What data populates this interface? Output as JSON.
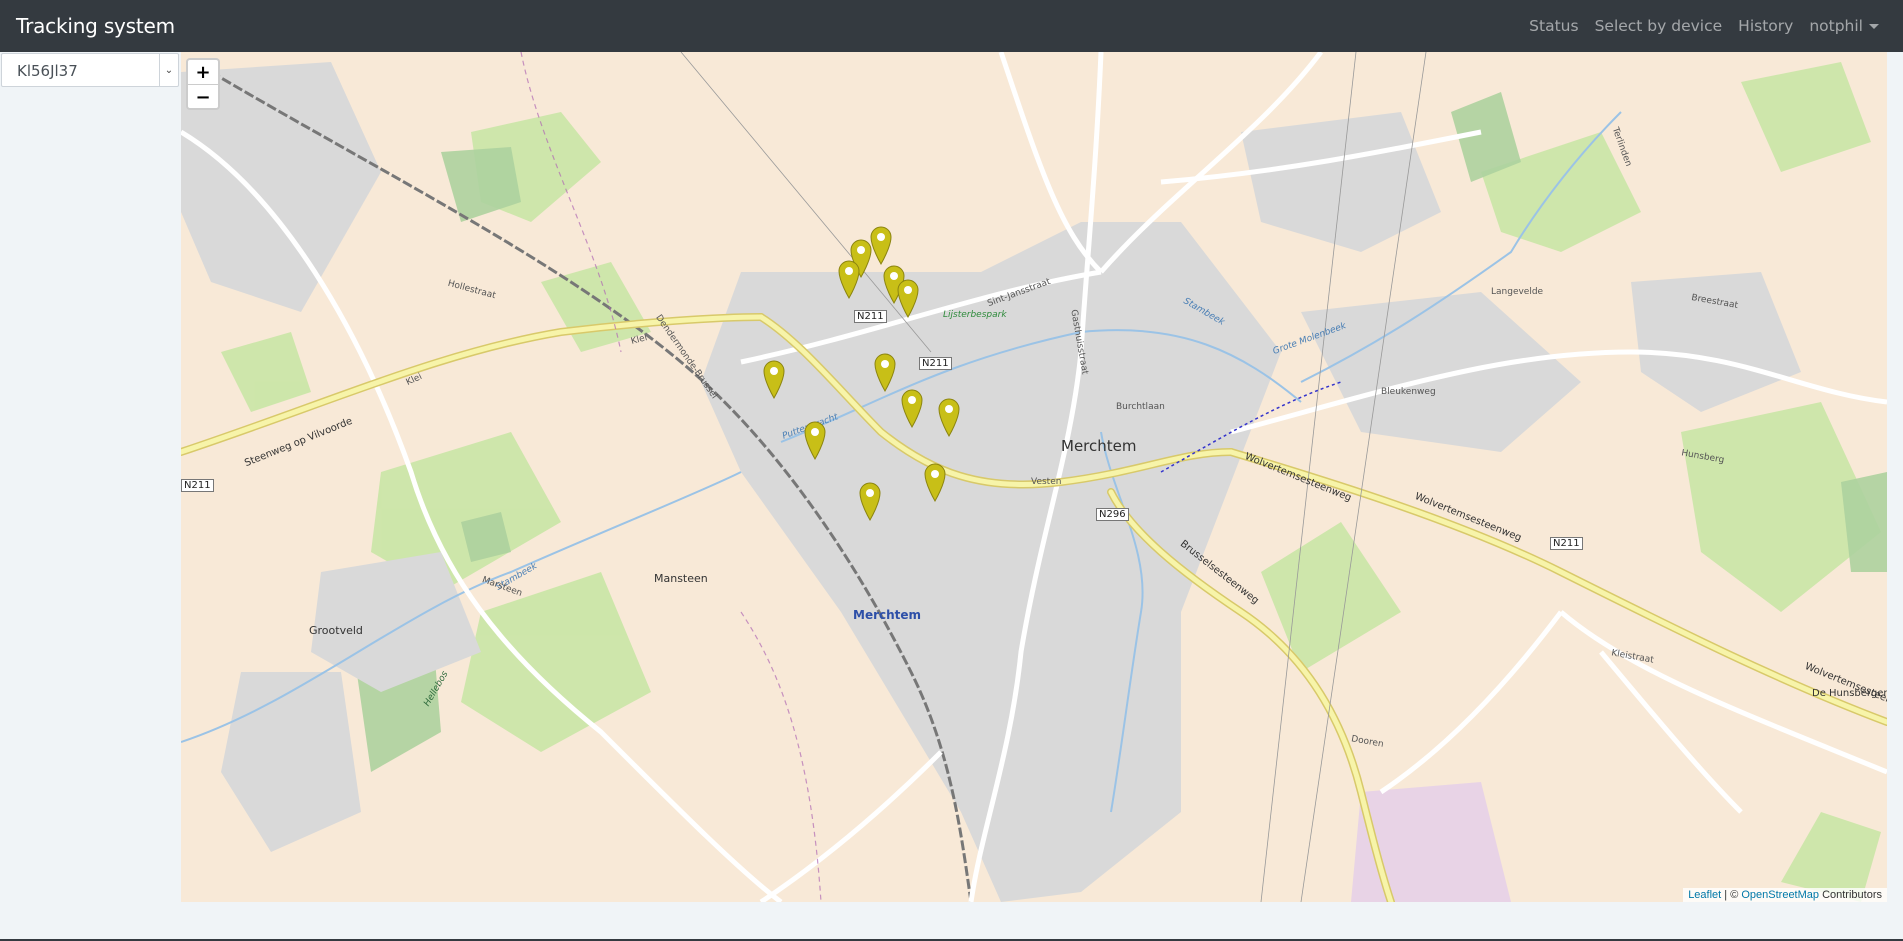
{
  "navbar": {
    "brand": "Tracking system",
    "links": [
      "Status",
      "Select by device",
      "History"
    ],
    "user": "notphil"
  },
  "sidebar": {
    "device_select_value": "Kl56Jl37"
  },
  "map": {
    "zoom_in": "+",
    "zoom_out": "−",
    "marker_count": 12,
    "marker_color": "#c8bf17",
    "labels": {
      "town": "Merchtem",
      "station": "Merchtem",
      "mansteen": "Mansteen",
      "grootveld": "Grootveld",
      "park": "Lijsterbespark",
      "hunsbergen": "De Hunsbergen",
      "road_n211_a": "N211",
      "road_n211_b": "N211",
      "road_n211_c": "N211",
      "road_n211_d": "N211",
      "road_n296": "N296",
      "wolvertem_1": "Wolvertemsesteenweg",
      "wolvertem_2": "Wolvertemsesteenweg",
      "brusselse": "Brusselsesteenweg",
      "steenweg_vilvoorde": "Steenweg op Vilvoorde",
      "klei": "Klei",
      "hollestraat": "Hollestraat",
      "stambeek": "Stambeek",
      "grote_molenbeek": "Grote Molenbeek",
      "puttengracht": "Puttengracht",
      "dooren": "Dooren",
      "kleistraat": "Kleistraat",
      "bleukenweg": "Bleukenweg",
      "burchtlaan": "Burchtlaan",
      "hunsberg": "Hunsberg",
      "langevelde": "Langevelde",
      "breestraat": "Breestraat",
      "marsteen": "Marsteen",
      "hellebos": "Hellebos",
      "terlinden": "Terlinden",
      "gasthuis": "Gasthuisstraat",
      "sint_jans": "Sint-Jansstraat",
      "vesten": "Vesten",
      "dendermonde": "Dendermonde-Brussel"
    },
    "attribution": {
      "leaflet": "Leaflet",
      "sep": " | © ",
      "osm": "OpenStreetMap",
      "contrib": " Contributors"
    }
  }
}
